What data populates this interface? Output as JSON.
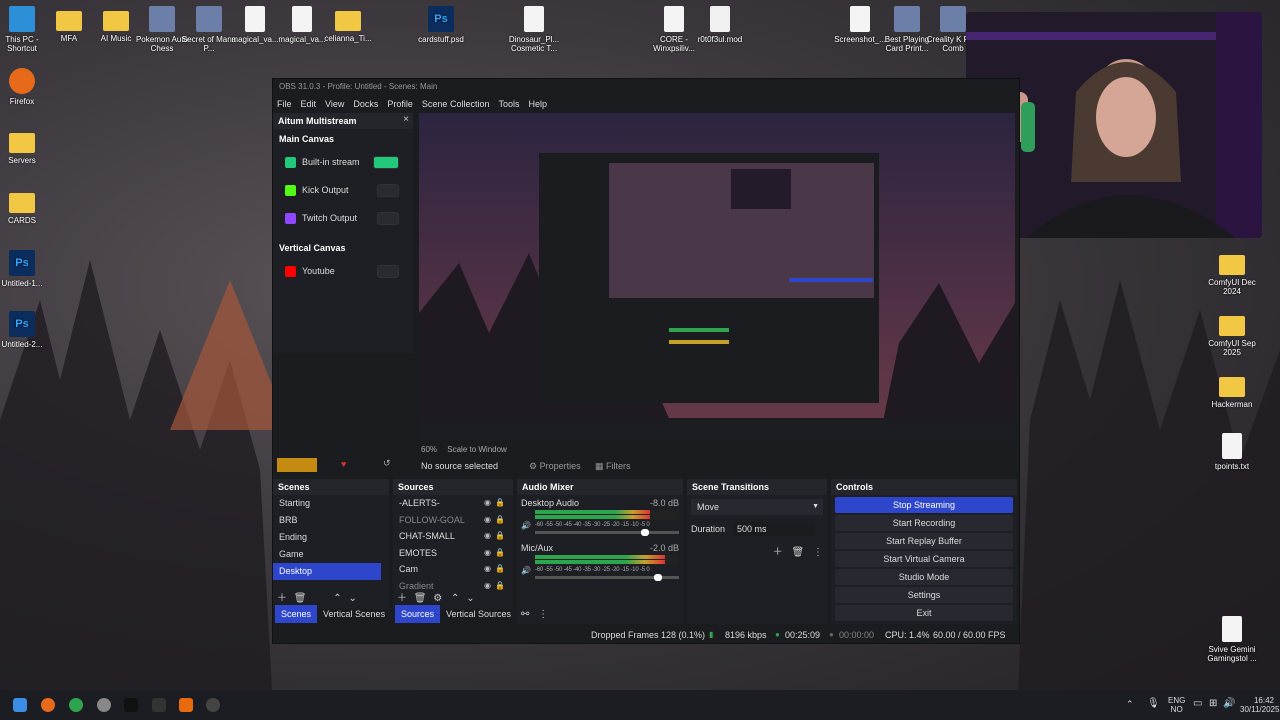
{
  "desktop_icons": [
    {
      "label": "This PC - Shortcut",
      "icon": "monitor-icon"
    },
    {
      "label": "MFA",
      "icon": "folder-icon"
    },
    {
      "label": "AI Music",
      "icon": "folder-icon"
    },
    {
      "label": "Pokemon Auto Chess",
      "icon": "app-icon"
    },
    {
      "label": "Secret of Mana P...",
      "icon": "app-icon"
    },
    {
      "label": "magical_va...",
      "icon": "file-icon"
    },
    {
      "label": "magical_va...",
      "icon": "file-icon"
    },
    {
      "label": "celianna_Ti...",
      "icon": "folder-icon"
    },
    {
      "label": "cardstuff.psd",
      "icon": "photoshop-icon"
    },
    {
      "label": "Dinosaur_Pl... Cosmetic T...",
      "icon": "file-icon"
    },
    {
      "label": "CORE - Winxpsiliv...",
      "icon": "file-icon"
    },
    {
      "label": "r0t0f3ul.mod",
      "icon": "media-icon"
    },
    {
      "label": "Screenshot_...",
      "icon": "file-icon"
    },
    {
      "label": "Best Playing Card Print...",
      "icon": "app-icon"
    },
    {
      "label": "Creality K Plus Comb",
      "icon": "app-icon"
    },
    {
      "label": "Firefox",
      "icon": "firefox-icon"
    },
    {
      "label": "Servers",
      "icon": "folder-icon"
    },
    {
      "label": "CARDS",
      "icon": "folder-icon"
    },
    {
      "label": "Untitled-1...",
      "icon": "photoshop-icon"
    },
    {
      "label": "Untitled-2...",
      "icon": "photoshop-icon"
    },
    {
      "label": "ComfyUI Dec 2024",
      "icon": "folder-icon"
    },
    {
      "label": "ComfyUI Sep 2025",
      "icon": "folder-icon"
    },
    {
      "label": "Hackerman",
      "icon": "folder-icon"
    },
    {
      "label": "tpoints.txt",
      "icon": "file-icon"
    },
    {
      "label": "Svive Gemini Gamingstol ...",
      "icon": "file-icon"
    }
  ],
  "obs": {
    "title": "OBS 31.0.3 - Profile: Untitled - Scenes: Main",
    "menu": [
      "File",
      "Edit",
      "View",
      "Docks",
      "Profile",
      "Scene Collection",
      "Tools",
      "Help"
    ],
    "multistream": {
      "title": "Aitum Multistream",
      "main_canvas": "Main Canvas",
      "outputs": [
        {
          "label": "Built-in stream",
          "color": "#23c97a",
          "active": true
        },
        {
          "label": "Kick Output",
          "color": "#53fc18",
          "active": false
        },
        {
          "label": "Twitch Output",
          "color": "#9146ff",
          "active": false
        }
      ],
      "vertical_canvas": "Vertical Canvas",
      "vertical_outputs": [
        {
          "label": "Youtube",
          "color": "#ff0000",
          "active": false
        }
      ]
    },
    "preview": {
      "zoom": "60%",
      "scale_mode": "Scale to Window"
    },
    "source_bar": {
      "no_source": "No source selected",
      "properties": "Properties",
      "filters": "Filters"
    },
    "scenes": {
      "title": "Scenes",
      "items": [
        "Starting",
        "BRB",
        "Ending",
        "Game",
        "Desktop"
      ],
      "selected": "Desktop",
      "tabs": [
        "Scenes",
        "Vertical Scenes"
      ]
    },
    "sources": {
      "title": "Sources",
      "items": [
        {
          "label": "-ALERTS-",
          "dim": false
        },
        {
          "label": "FOLLOW-GOAL",
          "dim": true
        },
        {
          "label": "CHAT-SMALL",
          "dim": false
        },
        {
          "label": "EMOTES",
          "dim": false
        },
        {
          "label": "Cam",
          "dim": false
        },
        {
          "label": "Gradient",
          "dim": true
        }
      ],
      "tabs": [
        "Sources",
        "Vertical Sources"
      ]
    },
    "mixer": {
      "title": "Audio Mixer",
      "channels": [
        {
          "name": "Desktop Audio",
          "db": "-8.0 dB",
          "level": 0.8
        },
        {
          "name": "Mic/Aux",
          "db": "-2.0 dB",
          "level": 0.9
        }
      ],
      "scale": "-60 -55 -50 -45 -40 -35 -30 -25 -20 -15 -10 -5 0"
    },
    "transitions": {
      "title": "Scene Transitions",
      "transition": "Move",
      "duration_label": "Duration",
      "duration": "500 ms"
    },
    "controls": {
      "title": "Controls",
      "buttons": [
        "Stop Streaming",
        "Start Recording",
        "Start Replay Buffer",
        "Start Virtual Camera",
        "Studio Mode",
        "Settings",
        "Exit"
      ]
    },
    "status": {
      "dropped": "Dropped Frames 128 (0.1%)",
      "bitrate": "8196 kbps",
      "stream_time": "00:25:09",
      "rec_time": "00:00:00",
      "cpu": "CPU: 1.4%",
      "fps": "60.00 / 60.00 FPS"
    }
  },
  "taskbar": {
    "lang1": "ENG",
    "lang2": "NO",
    "time": "16:42",
    "date": "30/11/2025"
  }
}
